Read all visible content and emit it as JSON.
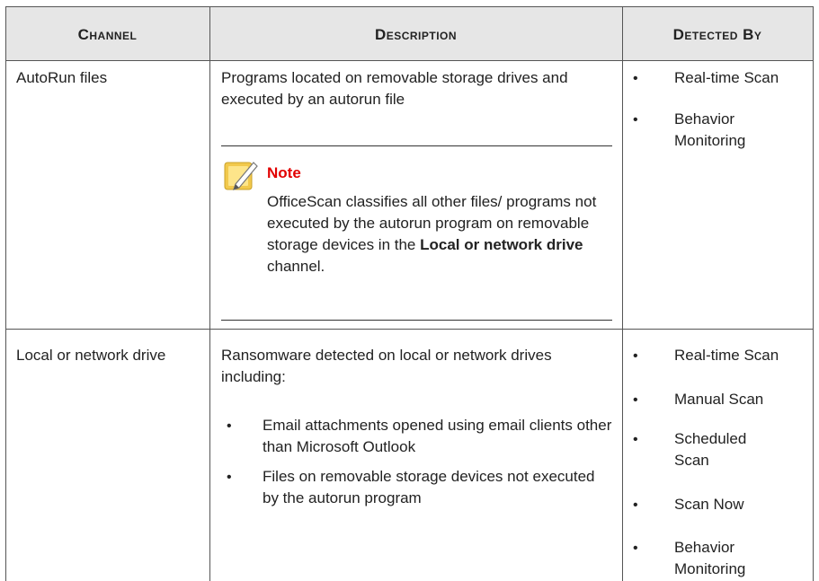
{
  "table": {
    "headers": [
      "Channel",
      "Description",
      "Detected By"
    ],
    "rows": [
      {
        "channel": "AutoRun files",
        "description": "Programs located on removable storage drives and executed by an autorun file",
        "note": {
          "title": "Note",
          "text_part1": "OfficeScan classifies all other files/ programs not executed by the autorun program on removable storage devices in the ",
          "bold": "Local or network drive",
          "text_part2": " channel."
        },
        "detected_by": [
          "Real-time Scan",
          "Behavior Monitoring"
        ]
      },
      {
        "channel": "Local or network drive",
        "description": "Ransomware detected on local or network drives including:",
        "description_items": [
          "Email attachments opened using email clients other than Microsoft Outlook",
          "Files on removable storage devices not executed by the autorun program"
        ],
        "detected_by": [
          "Real-time Scan",
          "Manual Scan",
          "Scheduled Scan",
          "Scan Now",
          "Behavior Monitoring"
        ]
      }
    ]
  },
  "colors": {
    "header_bg": "#e6e6e6",
    "note_title": "#e20000",
    "note_icon": "#f2c94c"
  },
  "icons": {
    "note": "note-pad-pencil-icon"
  }
}
